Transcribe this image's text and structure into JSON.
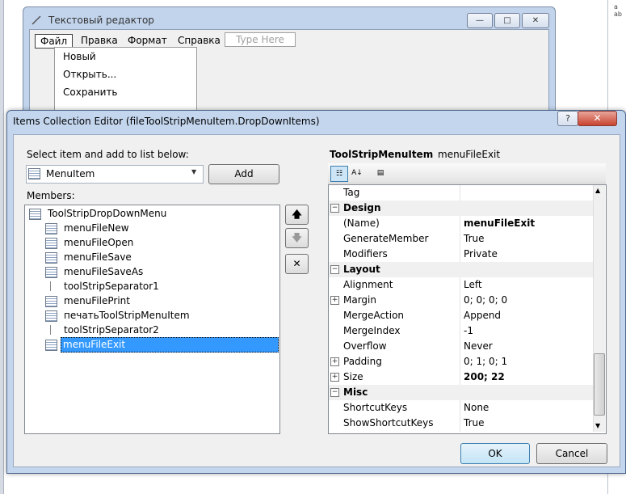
{
  "background": {
    "right_text": "a\nab"
  },
  "form_window": {
    "title": "Текстовый редактор",
    "min_label": "—",
    "max_label": "□",
    "close_label": "✕",
    "menu": [
      "Файл",
      "Правка",
      "Формат",
      "Справка"
    ],
    "type_here": "Type Here",
    "dropdown_items": [
      "Новый",
      "Открыть...",
      "Сохранить"
    ]
  },
  "dialog": {
    "title": "Items Collection Editor (fileToolStripMenuItem.DropDownItems)",
    "help_label": "?",
    "close_label": "✕",
    "select_label": "Select item and add to list below:",
    "combo_value": "MenuItem",
    "add_label": "Add",
    "members_label": "Members:",
    "members": [
      {
        "label": "ToolStripDropDownMenu",
        "kind": "root"
      },
      {
        "label": "menuFileNew",
        "kind": "item"
      },
      {
        "label": "menuFileOpen",
        "kind": "item"
      },
      {
        "label": "menuFileSave",
        "kind": "item"
      },
      {
        "label": "menuFileSaveAs",
        "kind": "item"
      },
      {
        "label": "toolStripSeparator1",
        "kind": "separator"
      },
      {
        "label": "menuFilePrint",
        "kind": "item"
      },
      {
        "label": "печатьToolStripMenuItem",
        "kind": "item"
      },
      {
        "label": "toolStripSeparator2",
        "kind": "separator"
      },
      {
        "label": "menuFileExit",
        "kind": "item",
        "selected": true
      }
    ],
    "move_up_label": "🡅",
    "move_down_label": "🡇",
    "delete_label": "✕",
    "property_header": {
      "type": "ToolStripMenuItem",
      "name": "menuFileExit"
    },
    "properties": [
      {
        "name": "Tag",
        "value": ""
      },
      {
        "category": "Design"
      },
      {
        "name": "(Name)",
        "value": "menuFileExit",
        "bold": true
      },
      {
        "name": "GenerateMember",
        "value": "True"
      },
      {
        "name": "Modifiers",
        "value": "Private"
      },
      {
        "category": "Layout"
      },
      {
        "name": "Alignment",
        "value": "Left"
      },
      {
        "name": "Margin",
        "value": "0; 0; 0; 0",
        "expandable": true
      },
      {
        "name": "MergeAction",
        "value": "Append"
      },
      {
        "name": "MergeIndex",
        "value": "-1"
      },
      {
        "name": "Overflow",
        "value": "Never"
      },
      {
        "name": "Padding",
        "value": "0; 1; 0; 1",
        "expandable": true
      },
      {
        "name": "Size",
        "value": "200; 22",
        "expandable": true,
        "bold": true
      },
      {
        "category": "Misc"
      },
      {
        "name": "ShortcutKeys",
        "value": "None"
      },
      {
        "name": "ShowShortcutKeys",
        "value": "True"
      }
    ],
    "ok_label": "OK",
    "cancel_label": "Cancel"
  }
}
